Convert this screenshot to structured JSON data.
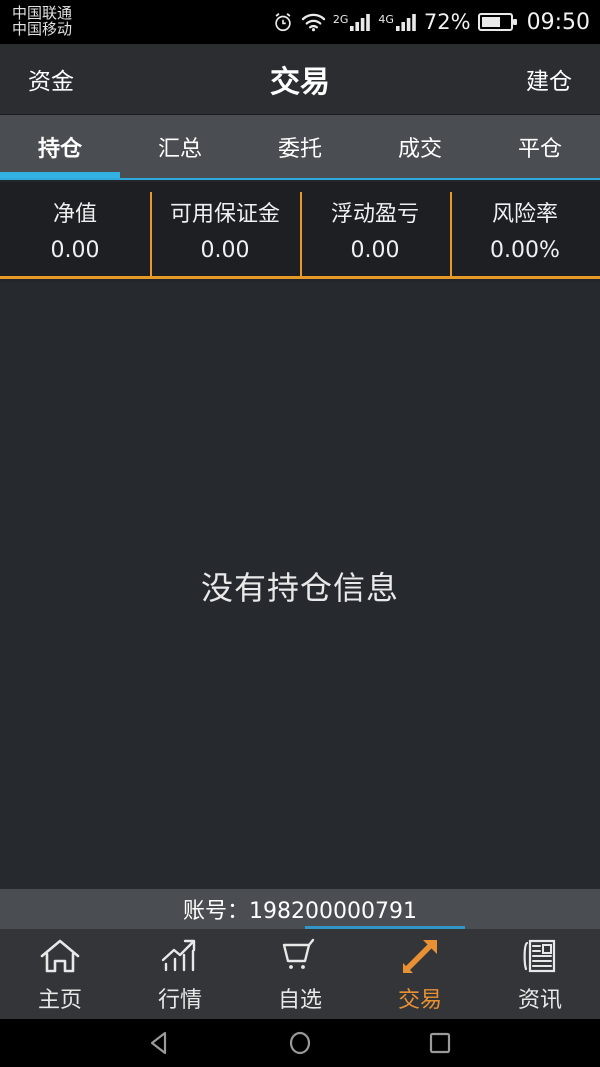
{
  "statusbar": {
    "carrier1": "中国联通",
    "carrier2": "中国移动",
    "alarm_icon": "alarm-clock-icon",
    "wifi_icon": "wifi-icon",
    "net1_label": "2G",
    "net2_label": "4G",
    "battery_percent": "72%",
    "clock": "09:50"
  },
  "header": {
    "left_label": "资金",
    "title": "交易",
    "right_label": "建仓"
  },
  "tabs": [
    {
      "label": "持仓",
      "active": true
    },
    {
      "label": "汇总",
      "active": false
    },
    {
      "label": "委托",
      "active": false
    },
    {
      "label": "成交",
      "active": false
    },
    {
      "label": "平仓",
      "active": false
    }
  ],
  "stats": [
    {
      "label": "净值",
      "value": "0.00"
    },
    {
      "label": "可用保证金",
      "value": "0.00"
    },
    {
      "label": "浮动盈亏",
      "value": "0.00"
    },
    {
      "label": "风险率",
      "value": "0.00%"
    }
  ],
  "content": {
    "empty_message": "没有持仓信息"
  },
  "account": {
    "text": "账号：198200000791"
  },
  "bottomnav": [
    {
      "label": "主页",
      "icon": "home-icon",
      "active": false
    },
    {
      "label": "行情",
      "icon": "chart-trend-up-icon",
      "active": false
    },
    {
      "label": "自选",
      "icon": "shopping-cart-icon",
      "active": false
    },
    {
      "label": "交易",
      "icon": "exchange-arrows-icon",
      "active": true
    },
    {
      "label": "资讯",
      "icon": "newspaper-icon",
      "active": false
    }
  ],
  "androidnav": {
    "back": "back-triangle-icon",
    "home": "home-circle-icon",
    "recents": "recents-square-icon"
  },
  "colors": {
    "accent_orange": "#e89134",
    "accent_blue": "#33b1e4",
    "divider_orange": "#e79a28",
    "bg_content": "#26292e",
    "bg_header": "#2b2d31",
    "bg_tabs": "#4a4d52"
  }
}
